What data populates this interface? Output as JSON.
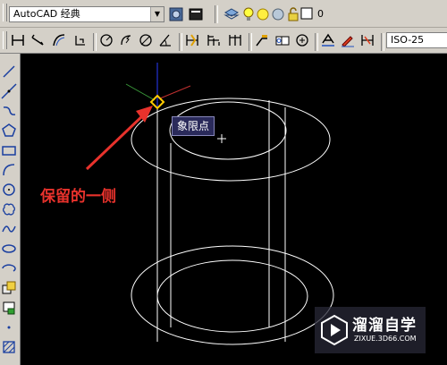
{
  "toolbar1": {
    "workspace_value": "AutoCAD 经典",
    "layer_name": "0",
    "icons": [
      "workspace-settings-icon",
      "workspace-toggle-icon",
      "layer-manager-icon",
      "lightbulb-icon",
      "sun-icon",
      "freeze-icon",
      "lock-icon",
      "layer-color-swatch"
    ]
  },
  "toolbar2": {
    "dimstyle_value": "ISO-25",
    "icons": [
      "linear-dimension-icon",
      "aligned-dimension-icon",
      "arc-length-icon",
      "ordinate-icon",
      "radius-icon",
      "jogged-icon",
      "diameter-icon",
      "angular-icon",
      "quick-dimension-icon",
      "baseline-icon",
      "continue-icon",
      "quick-leader-icon",
      "tolerance-icon",
      "center-mark-icon",
      "dimension-edit-icon",
      "dimension-text-edit-icon",
      "dimension-update-icon"
    ]
  },
  "left_toolbar": {
    "icons": [
      "line-icon",
      "construction-line-icon",
      "polyline-icon",
      "polygon-icon",
      "rectangle-icon",
      "arc-icon",
      "circle-icon",
      "revision-cloud-icon",
      "spline-icon",
      "ellipse-icon",
      "ellipse-arc-icon",
      "insert-block-icon",
      "make-block-icon",
      "point-icon",
      "hatch-icon"
    ]
  },
  "canvas": {
    "background": "#000000",
    "tooltip": "象限点",
    "annotation": "保留的一侧",
    "annotation_color": "#e8322c"
  },
  "watermark": {
    "title": "溜溜自学",
    "subtitle": "ZIXUE.3D66.COM"
  }
}
